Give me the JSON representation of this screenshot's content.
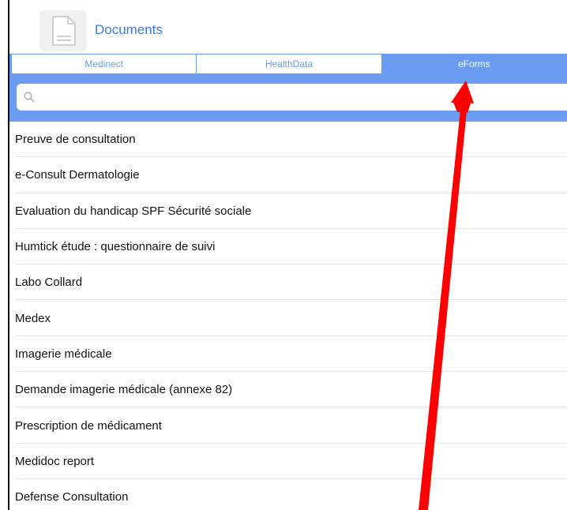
{
  "header": {
    "title": "Documents",
    "icon": "document-icon"
  },
  "tabs": [
    {
      "label": "Medinect",
      "active": false
    },
    {
      "label": "HealthData",
      "active": false
    },
    {
      "label": "eForms",
      "active": true
    }
  ],
  "search": {
    "value": "",
    "placeholder": "",
    "icon": "search-icon"
  },
  "items": [
    {
      "label": "Preuve de consultation"
    },
    {
      "label": "e-Consult Dermatologie"
    },
    {
      "label": "Evaluation du handicap SPF Sécurité sociale"
    },
    {
      "label": "Humtick étude : questionnaire de suivi"
    },
    {
      "label": "Labo Collard"
    },
    {
      "label": "Medex"
    },
    {
      "label": "Imagerie médicale"
    },
    {
      "label": "Demande imagerie médicale (annexe 82)"
    },
    {
      "label": "Prescription de médicament"
    },
    {
      "label": "Medidoc report"
    },
    {
      "label": "Defense Consultation"
    }
  ],
  "colors": {
    "accent": "#6a9cf2",
    "title": "#3b7be0",
    "annotation_arrow": "#ff0000"
  }
}
